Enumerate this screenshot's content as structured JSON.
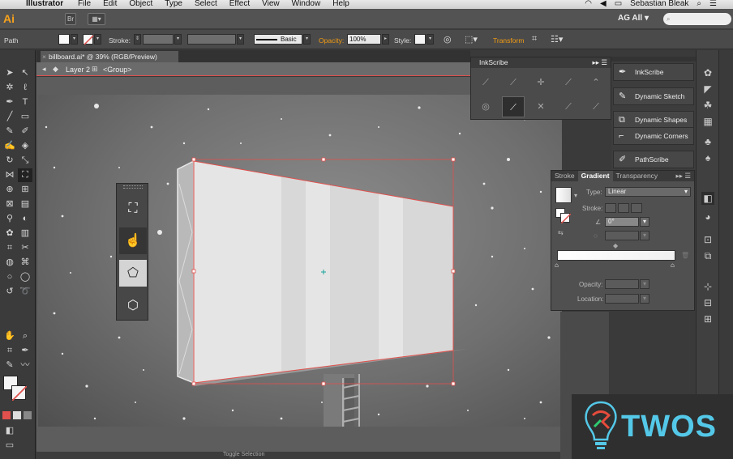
{
  "menubar": {
    "app_name": "Illustrator",
    "menus": [
      "File",
      "Edit",
      "Object",
      "Type",
      "Select",
      "Effect",
      "View",
      "Window",
      "Help"
    ],
    "user": "Sebastian Bleak"
  },
  "appbar": {
    "logo": "Ai",
    "bridge": "Br",
    "workspace": "AG All",
    "workspace_arrow": "▾"
  },
  "controlbar": {
    "selection": "Path",
    "stroke_label": "Stroke:",
    "brush_style": "Basic",
    "opacity_label": "Opacity:",
    "opacity_value": "100%",
    "style_label": "Style:",
    "transform_link": "Transform"
  },
  "document": {
    "tab_title": "billboard.ai* @ 39% (RGB/Preview)",
    "close_x": "×",
    "layer": "Layer 2",
    "group": "<Group>"
  },
  "inkscribe": {
    "title": "InkScribe",
    "icons_row1": [
      "smooth-anchor-icon",
      "curve-anchor-icon",
      "corner-anchor-icon",
      "handle-anchor-icon",
      "cusp-anchor-icon"
    ],
    "icons_row2": [
      "close-path-icon",
      "convert-anchor-icon",
      "delete-anchor-icon",
      "rubber-band-icon",
      "options-icon"
    ]
  },
  "extensions": [
    {
      "label": "InkScribe",
      "icon": "pen-icon"
    },
    {
      "label": "Dynamic Sketch",
      "icon": "pencil-icon"
    },
    {
      "label": "Dynamic Shapes",
      "icon": "shapes-icon"
    },
    {
      "label": "Dynamic Corners",
      "icon": "corners-icon"
    },
    {
      "label": "PathScribe",
      "icon": "path-icon"
    }
  ],
  "gradient_panel": {
    "tabs": [
      "Stroke",
      "Gradient",
      "Transparency"
    ],
    "type_label": "Type:",
    "type_value": "Linear",
    "stroke_label": "Stroke:",
    "angle_value": "0°",
    "opacity_label": "Opacity:",
    "location_label": "Location:"
  },
  "colors": {
    "accent_orange": "#f39c12",
    "selection_red": "#e0514d",
    "watermark_blue": "#54c8e8"
  },
  "watermark": {
    "text": "TWOS"
  },
  "status": {
    "tool_label": "Toggle Selection"
  }
}
